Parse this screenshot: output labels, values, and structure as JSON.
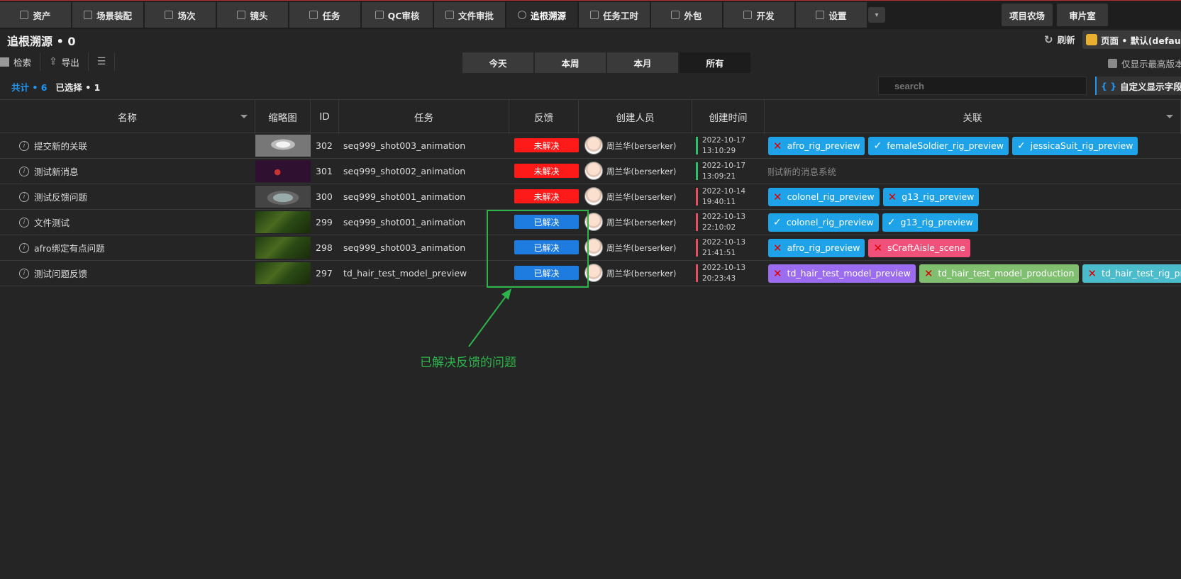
{
  "nav": {
    "tabs": [
      {
        "label": "资产",
        "icon": "asset-icon"
      },
      {
        "label": "场景装配",
        "icon": "scene-icon"
      },
      {
        "label": "场次",
        "icon": "sequence-icon"
      },
      {
        "label": "镜头",
        "icon": "shot-icon"
      },
      {
        "label": "任务",
        "icon": "task-icon"
      },
      {
        "label": "QC审核",
        "icon": "qc-icon"
      },
      {
        "label": "文件审批",
        "icon": "approval-icon"
      },
      {
        "label": "追根溯源",
        "icon": "trace-icon",
        "active": true
      },
      {
        "label": "任务工时",
        "icon": "timelog-icon"
      },
      {
        "label": "外包",
        "icon": "outsource-icon"
      },
      {
        "label": "开发",
        "icon": "code-icon"
      },
      {
        "label": "设置",
        "icon": "settings-icon"
      }
    ],
    "project_farm": "项目农场",
    "review_room": "审片室"
  },
  "header": {
    "title": "追根溯源 • 0",
    "refresh": "刷新",
    "page_layout": "页面 • 默认(default)"
  },
  "toolbar": {
    "search_label": "检索",
    "export_label": "导出",
    "time_filters": [
      "今天",
      "本周",
      "本月",
      "所有"
    ],
    "active_filter": "所有",
    "latest_only": "仅显示最高版本",
    "total": "共计 • 6",
    "selected": "已选择 • 1",
    "search_placeholder": "search",
    "custom_fields": "自定义显示字段"
  },
  "table": {
    "columns": [
      "名称",
      "缩略图",
      "ID",
      "任务",
      "反馈",
      "创建人员",
      "创建时间",
      "关联"
    ],
    "rows": [
      {
        "name": "提交新的关联",
        "id": "302",
        "task": "seq999_shot003_animation",
        "status": "未解决",
        "creator": "周兰华(berserker)",
        "date": "2022-10-17",
        "time": "13:10:29",
        "bar": "green",
        "thumb": "silver",
        "links": [
          {
            "label": "afro_rig_preview",
            "state": "x",
            "color": "#1fa3e8"
          },
          {
            "label": "femaleSoldier_rig_preview",
            "state": "ok",
            "color": "#1fa3e8"
          },
          {
            "label": "jessicaSuit_rig_preview",
            "state": "ok",
            "color": "#1fa3e8"
          }
        ]
      },
      {
        "name": "测试新消息",
        "id": "301",
        "task": "seq999_shot002_animation",
        "status": "未解决",
        "creator": "周兰华(berserker)",
        "date": "2022-10-17",
        "time": "13:09:21",
        "bar": "green",
        "thumb": "stage",
        "note": "测试新的消息系统",
        "links": []
      },
      {
        "name": "测试反馈问题",
        "id": "300",
        "task": "seq999_shot001_animation",
        "status": "未解决",
        "creator": "周兰华(berserker)",
        "date": "2022-10-14",
        "time": "19:40:11",
        "bar": "red",
        "thumb": "gray",
        "links": [
          {
            "label": "colonel_rig_preview",
            "state": "x",
            "color": "#1fa3e8"
          },
          {
            "label": "g13_rig_preview",
            "state": "x",
            "color": "#1fa3e8"
          }
        ]
      },
      {
        "name": "文件测试",
        "id": "299",
        "task": "seq999_shot001_animation",
        "status": "已解决",
        "creator": "周兰华(berserker)",
        "date": "2022-10-13",
        "time": "22:10:02",
        "bar": "red",
        "thumb": "terrain",
        "links": [
          {
            "label": "colonel_rig_preview",
            "state": "ok",
            "color": "#1fa3e8"
          },
          {
            "label": "g13_rig_preview",
            "state": "ok",
            "color": "#1fa3e8"
          }
        ]
      },
      {
        "name": "afro绑定有点问题",
        "id": "298",
        "task": "seq999_shot003_animation",
        "status": "已解决",
        "creator": "周兰华(berserker)",
        "date": "2022-10-13",
        "time": "21:41:51",
        "bar": "red",
        "thumb": "terrain",
        "links": [
          {
            "label": "afro_rig_preview",
            "state": "x",
            "color": "#1fa3e8"
          },
          {
            "label": "sCraftAisle_scene",
            "state": "x",
            "color": "#f0507a"
          }
        ]
      },
      {
        "name": "测试问题反馈",
        "id": "297",
        "task": "td_hair_test_model_preview",
        "status": "已解决",
        "creator": "周兰华(berserker)",
        "date": "2022-10-13",
        "time": "20:23:43",
        "bar": "red",
        "thumb": "terrain",
        "links": [
          {
            "label": "td_hair_test_model_preview",
            "state": "x",
            "color": "#9b6cf0"
          },
          {
            "label": "td_hair_test_model_production",
            "state": "x",
            "color": "#7fbf6f"
          },
          {
            "label": "td_hair_test_rig_production",
            "state": "x",
            "color": "#4bbccc"
          }
        ]
      }
    ]
  },
  "annotation": "已解决反馈的问题",
  "colors": {
    "unresolved": "#ff1a1a",
    "resolved": "#1e7be0",
    "accent": "#2196f3",
    "annotation": "#2db34a"
  }
}
